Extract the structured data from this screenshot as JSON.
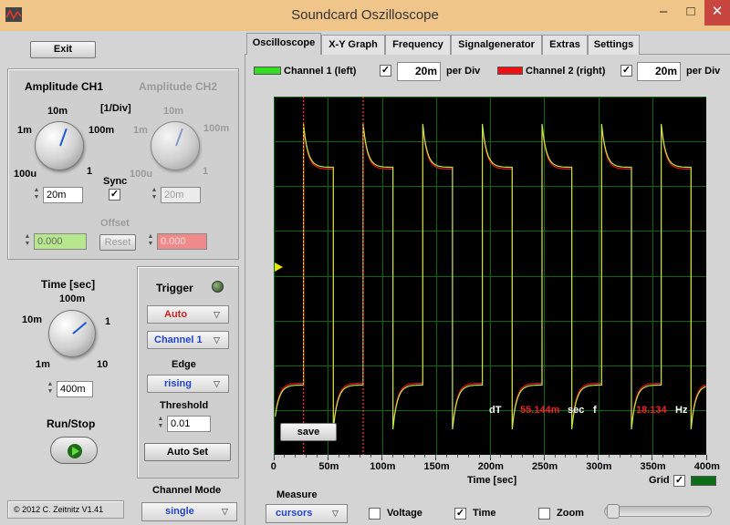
{
  "window": {
    "title": "Soundcard Oszilloscope",
    "min_symbol": "–",
    "max_symbol": "□",
    "close_symbol": "✕"
  },
  "left": {
    "exit_label": "Exit",
    "amp_ch1": {
      "title": "Amplitude CH1",
      "t_10m": "10m",
      "t_1m": "1m",
      "t_100m": "100m",
      "t_100u": "100u",
      "t_1": "1",
      "value": "20m"
    },
    "amp_ch2": {
      "title": "Amplitude CH2",
      "t_10m": "10m",
      "t_1m": "1m",
      "t_100m": "100m",
      "t_100u": "100u",
      "t_1": "1",
      "value": "20m"
    },
    "div_label": "[1/Div]",
    "sync_label": "Sync",
    "sync_mark": "✓",
    "offset_label": "Offset",
    "offset_ch1": "0.000",
    "offset_ch2": "0.000",
    "reset_label": "Reset",
    "time": {
      "title": "Time [sec]",
      "t_100m": "100m",
      "t_10m": "10m",
      "t_1": "1",
      "t_1m": "1m",
      "t_10": "10",
      "value": "400m"
    },
    "runstop_label": "Run/Stop",
    "copyright": "© 2012  C. Zeitnitz V1.41"
  },
  "trigger": {
    "title": "Trigger",
    "mode": "Auto",
    "channel": "Channel 1",
    "edge_label": "Edge",
    "edge": "rising",
    "threshold_label": "Threshold",
    "threshold": "0.01",
    "autoset_label": "Auto Set",
    "channel_mode_label": "Channel Mode",
    "channel_mode": "single"
  },
  "tabs": [
    "Oscilloscope",
    "X-Y Graph",
    "Frequency",
    "Signalgenerator",
    "Extras",
    "Settings"
  ],
  "channels": {
    "ch1_label": "Channel 1 (left)",
    "ch1_color": "#33dd22",
    "ch1_div": "20m",
    "ch2_label": "Channel 2 (right)",
    "ch2_color": "#ee1111",
    "ch2_div": "20m",
    "per_div": "per Div",
    "check_mark": "✓"
  },
  "scope": {
    "save_label": "save",
    "dt_label": "dT",
    "dt_value": "55.144m",
    "dt_unit": "sec",
    "f_label": "f",
    "f_value": "18.134",
    "f_unit": "Hz",
    "xlabel": "Time [sec]",
    "x_ticks": [
      "0",
      "50m",
      "100m",
      "150m",
      "200m",
      "250m",
      "300m",
      "350m",
      "400m"
    ],
    "grid_label": "Grid",
    "cursor1_t": 0.0275,
    "cursor2_t": 0.0827
  },
  "measure": {
    "label": "Measure",
    "mode": "cursors",
    "voltage_label": "Voltage",
    "time_label": "Time",
    "zoom_label": "Zoom",
    "check_mark": "✓"
  },
  "chart_data": {
    "type": "line",
    "xlabel": "Time [sec]",
    "xlim": [
      0,
      0.4
    ],
    "x_tick_labels": [
      "0",
      "50m",
      "100m",
      "150m",
      "200m",
      "250m",
      "300m",
      "350m",
      "400m"
    ],
    "grid": true,
    "series": [
      {
        "name": "Channel 1 (left)",
        "color": "#33dd22",
        "period": 0.05514,
        "duty": 0.5
      },
      {
        "name": "Channel 2 (right)",
        "color": "#ee1111",
        "period": 0.05514,
        "duty": 0.5
      }
    ]
  }
}
